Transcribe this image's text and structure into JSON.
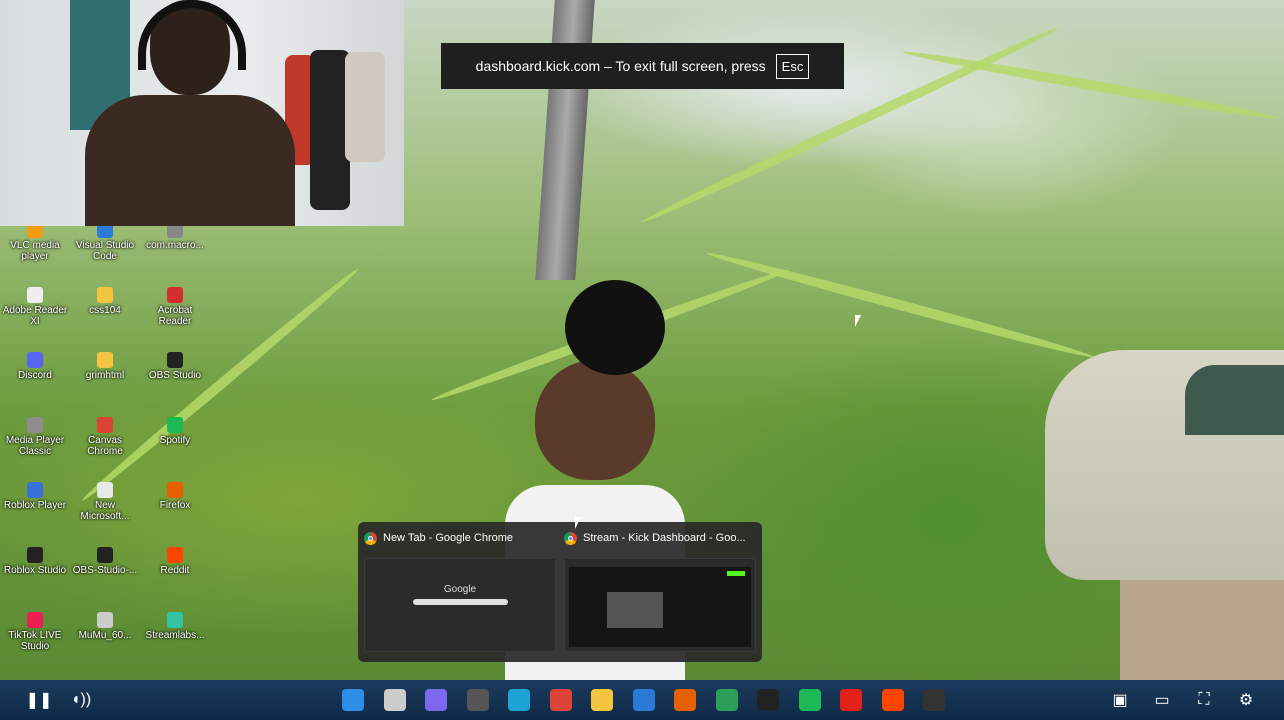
{
  "fullscreen_notice": {
    "text": "dashboard.kick.com – To exit full screen, press",
    "key": "Esc"
  },
  "desktop_icons": [
    {
      "label": "VLC media player",
      "icon": "vlc-icon",
      "color": "#f39c12"
    },
    {
      "label": "Visual Studio Code",
      "icon": "vscode-icon",
      "color": "#2b7bd6"
    },
    {
      "label": "com.macro...",
      "icon": "app-icon",
      "color": "#888888"
    },
    {
      "label": "Adobe Reader XI",
      "icon": "pdf-icon",
      "color": "#eeeeee"
    },
    {
      "label": "css104",
      "icon": "folder-icon",
      "color": "#f5c542"
    },
    {
      "label": "Acrobat Reader",
      "icon": "acrobat-icon",
      "color": "#d32f2f"
    },
    {
      "label": "Discord",
      "icon": "discord-icon",
      "color": "#5865f2"
    },
    {
      "label": "grimhtml",
      "icon": "folder-icon",
      "color": "#f5c542"
    },
    {
      "label": "OBS Studio",
      "icon": "obs-icon",
      "color": "#222222"
    },
    {
      "label": "Media Player Classic",
      "icon": "media-player-icon",
      "color": "#8e8e8e"
    },
    {
      "label": "Canvas Chrome",
      "icon": "chrome-icon",
      "color": "#db4437"
    },
    {
      "label": "Spotify",
      "icon": "spotify-icon",
      "color": "#1db954"
    },
    {
      "label": "Roblox Player",
      "icon": "roblox-icon",
      "color": "#3b6fd8"
    },
    {
      "label": "New Microsoft...",
      "icon": "document-icon",
      "color": "#e8e8e8"
    },
    {
      "label": "Firefox",
      "icon": "firefox-icon",
      "color": "#e66000"
    },
    {
      "label": "Roblox Studio",
      "icon": "roblox-studio-icon",
      "color": "#222222"
    },
    {
      "label": "OBS-Studio-...",
      "icon": "obs-icon",
      "color": "#222222"
    },
    {
      "label": "Reddit",
      "icon": "reddit-icon",
      "color": "#ff4500"
    },
    {
      "label": "TikTok LIVE Studio",
      "icon": "tiktok-icon",
      "color": "#ee1d52"
    },
    {
      "label": "MuMu_60...",
      "icon": "mumu-icon",
      "color": "#cccccc"
    },
    {
      "label": "Streamlabs...",
      "icon": "streamlabs-icon",
      "color": "#31c3a2"
    }
  ],
  "taskbar_previews": [
    {
      "title": "New Tab - Google Chrome",
      "thumb_text": "Google"
    },
    {
      "title": "Stream - Kick Dashboard - Goo...",
      "thumb_text": ""
    }
  ],
  "taskbar": {
    "left_controls": [
      {
        "name": "pause-icon",
        "glyph": "❚❚"
      },
      {
        "name": "volume-icon",
        "glyph": "◖))"
      }
    ],
    "apps": [
      {
        "name": "start-icon",
        "color": "#2d8fe8"
      },
      {
        "name": "file-icon",
        "color": "#cccccc"
      },
      {
        "name": "photos-icon",
        "color": "#7b68ee"
      },
      {
        "name": "video-editor-icon",
        "color": "#555555"
      },
      {
        "name": "edge-icon",
        "color": "#1fa3d6"
      },
      {
        "name": "chrome-icon",
        "color": "#db4437"
      },
      {
        "name": "file-explorer-icon",
        "color": "#f5c542"
      },
      {
        "name": "vscode-icon",
        "color": "#2b7bd6"
      },
      {
        "name": "firefox-icon",
        "color": "#e66000"
      },
      {
        "name": "green-app-icon",
        "color": "#2e9e5b"
      },
      {
        "name": "roblox-studio-icon",
        "color": "#222222"
      },
      {
        "name": "spotify-icon",
        "color": "#1db954"
      },
      {
        "name": "youtube-icon",
        "color": "#e62117"
      },
      {
        "name": "reddit-icon",
        "color": "#ff4500"
      },
      {
        "name": "obs-icon",
        "color": "#333333"
      }
    ],
    "right_controls": [
      {
        "name": "miniplayer-icon",
        "glyph": "▣"
      },
      {
        "name": "theater-icon",
        "glyph": "▭"
      },
      {
        "name": "fullscreen-icon",
        "glyph": "⛶"
      },
      {
        "name": "settings-icon",
        "glyph": "⚙"
      }
    ]
  }
}
